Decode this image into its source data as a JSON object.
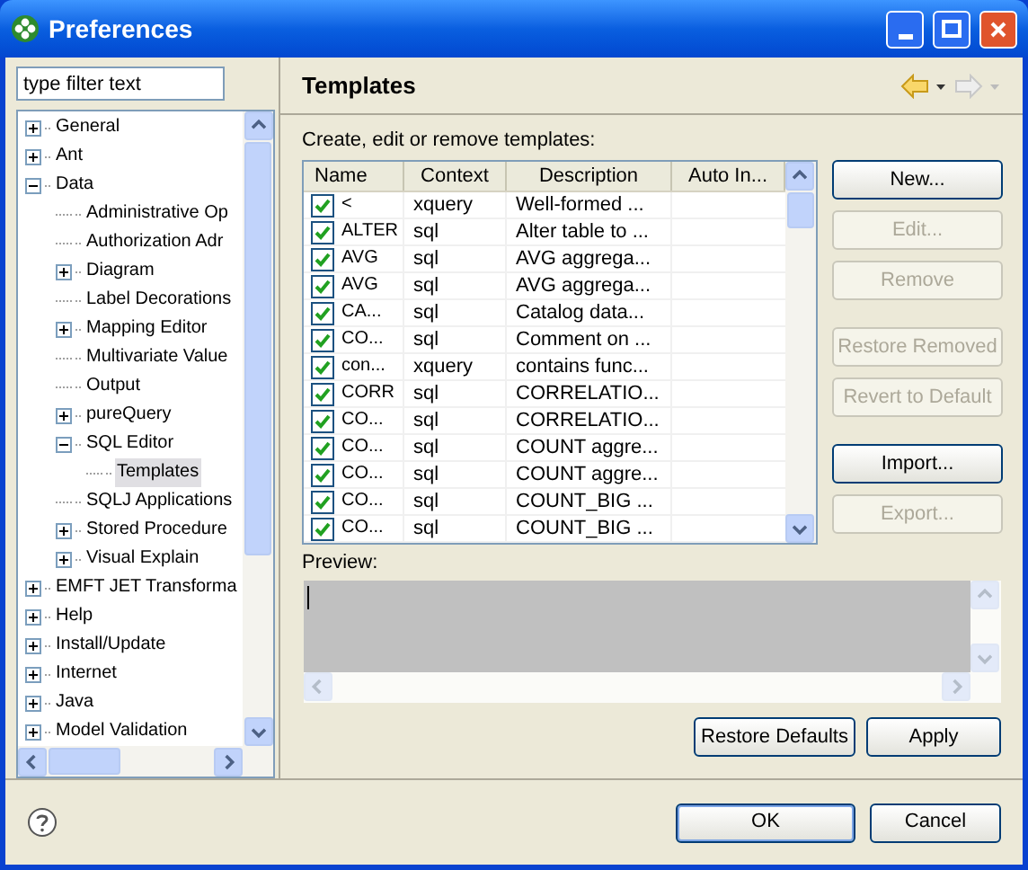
{
  "window": {
    "title": "Preferences"
  },
  "filter": {
    "placeholder": "type filter text"
  },
  "tree": [
    {
      "label": "General",
      "kind": "folder",
      "expanded": false,
      "selected": false
    },
    {
      "label": "Ant",
      "kind": "folder",
      "expanded": false,
      "selected": false
    },
    {
      "label": "Data",
      "kind": "folder",
      "expanded": true,
      "selected": false,
      "children": [
        {
          "label": "Administrative Op",
          "kind": "leaf",
          "selected": false
        },
        {
          "label": "Authorization Adr",
          "kind": "leaf",
          "selected": false
        },
        {
          "label": "Diagram",
          "kind": "folder",
          "expanded": false,
          "selected": false
        },
        {
          "label": "Label Decorations",
          "kind": "leaf",
          "selected": false
        },
        {
          "label": "Mapping Editor",
          "kind": "folder",
          "expanded": false,
          "selected": false
        },
        {
          "label": "Multivariate Value",
          "kind": "leaf",
          "selected": false
        },
        {
          "label": "Output",
          "kind": "leaf",
          "selected": false
        },
        {
          "label": "pureQuery",
          "kind": "folder",
          "expanded": false,
          "selected": false
        },
        {
          "label": "SQL Editor",
          "kind": "folder",
          "expanded": true,
          "selected": false,
          "children": [
            {
              "label": "Templates",
              "kind": "leaf",
              "selected": true
            }
          ]
        },
        {
          "label": "SQLJ Applications",
          "kind": "leaf",
          "selected": false
        },
        {
          "label": "Stored Procedure",
          "kind": "folder",
          "expanded": false,
          "selected": false
        },
        {
          "label": "Visual Explain",
          "kind": "folder",
          "expanded": false,
          "selected": false
        }
      ]
    },
    {
      "label": "EMFT JET Transforma",
      "kind": "folder",
      "expanded": false,
      "selected": false
    },
    {
      "label": "Help",
      "kind": "folder",
      "expanded": false,
      "selected": false
    },
    {
      "label": "Install/Update",
      "kind": "folder",
      "expanded": false,
      "selected": false
    },
    {
      "label": "Internet",
      "kind": "folder",
      "expanded": false,
      "selected": false
    },
    {
      "label": "Java",
      "kind": "folder",
      "expanded": false,
      "selected": false
    },
    {
      "label": "Model Validation",
      "kind": "folder",
      "expanded": false,
      "selected": false
    }
  ],
  "page": {
    "title": "Templates",
    "nav": {
      "back_enabled": true,
      "forward_enabled": false
    },
    "intro": "Create, edit or remove templates:"
  },
  "table": {
    "columns": [
      "Name",
      "Context",
      "Description",
      "Auto In..."
    ],
    "rows": [
      {
        "name": "<",
        "context": "xquery",
        "description": "Well-formed ...",
        "checked": true
      },
      {
        "name": "ALTER",
        "context": "sql",
        "description": "Alter table to ...",
        "checked": true
      },
      {
        "name": "AVG",
        "context": "sql",
        "description": "AVG aggrega...",
        "checked": true
      },
      {
        "name": "AVG",
        "context": "sql",
        "description": "AVG aggrega...",
        "checked": true
      },
      {
        "name": "CA...",
        "context": "sql",
        "description": "Catalog data...",
        "checked": true
      },
      {
        "name": "CO...",
        "context": "sql",
        "description": "Comment on ...",
        "checked": true
      },
      {
        "name": "con...",
        "context": "xquery",
        "description": "contains func...",
        "checked": true
      },
      {
        "name": "CORR",
        "context": "sql",
        "description": "CORRELATIO...",
        "checked": true
      },
      {
        "name": "CO...",
        "context": "sql",
        "description": "CORRELATIO...",
        "checked": true
      },
      {
        "name": "CO...",
        "context": "sql",
        "description": "COUNT aggre...",
        "checked": true
      },
      {
        "name": "CO...",
        "context": "sql",
        "description": "COUNT aggre...",
        "checked": true
      },
      {
        "name": "CO...",
        "context": "sql",
        "description": "COUNT_BIG ...",
        "checked": true
      },
      {
        "name": "CO...",
        "context": "sql",
        "description": "COUNT_BIG ...",
        "checked": true
      }
    ]
  },
  "side_buttons": [
    {
      "label": "New...",
      "disabled": false
    },
    {
      "label": "Edit...",
      "disabled": true
    },
    {
      "label": "Remove",
      "disabled": true
    },
    {
      "label": "Restore Removed",
      "disabled": true
    },
    {
      "label": "Revert to Default",
      "disabled": true
    },
    {
      "label": "Import...",
      "disabled": false
    },
    {
      "label": "Export...",
      "disabled": true
    }
  ],
  "preview": {
    "label": "Preview:"
  },
  "page_buttons": [
    "Restore Defaults",
    "Apply"
  ],
  "dialog_buttons": [
    "OK",
    "Cancel"
  ]
}
